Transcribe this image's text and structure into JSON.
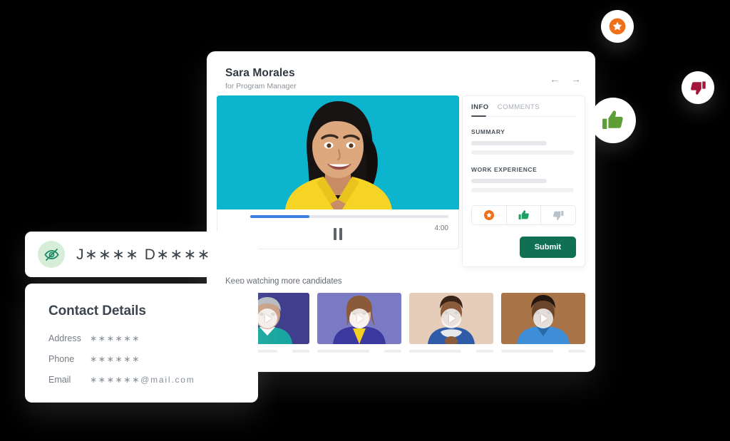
{
  "window": {
    "candidate_name": "Sara Morales",
    "candidate_role": "for Program Manager",
    "nav": {
      "prev": "←",
      "next": "→"
    }
  },
  "video": {
    "time_remaining": "4:00",
    "progress_percent": 30,
    "state": "playing",
    "background_color": "#0cb4ce",
    "progress_color": "#3b7fe0"
  },
  "panel": {
    "tabs": [
      {
        "label": "INFO",
        "active": true
      },
      {
        "label": "COMMENTS",
        "active": false
      }
    ],
    "sections": [
      {
        "title": "SUMMARY"
      },
      {
        "title": "WORK EXPERIENCE"
      }
    ],
    "reactions": [
      {
        "name": "star-badge-icon",
        "color": "#ef7018"
      },
      {
        "name": "thumbs-up-icon",
        "color": "#1f9d62"
      },
      {
        "name": "thumbs-down-icon",
        "color": "#b7c3cc"
      }
    ],
    "submit_label": "Submit",
    "submit_color": "#0f7054"
  },
  "keep_watching": {
    "heading": "Keep watching more candidates",
    "thumbnails": [
      {
        "name": "candidate-thumbnail-1",
        "bg": "#3f3f8e",
        "skin": "#c9a289",
        "shirt": "#1aa6a0",
        "hair": "#b9bcc2"
      },
      {
        "name": "candidate-thumbnail-2",
        "bg": "#7b7ac4",
        "skin": "#e0b79c",
        "shirt": "#3b38a0",
        "hair": "#8a5a3b"
      },
      {
        "name": "candidate-thumbnail-3",
        "bg": "#e6cdb9",
        "skin": "#8a5c3c",
        "shirt": "#2f5ba8",
        "hair": "#3a2418"
      },
      {
        "name": "candidate-thumbnail-4",
        "bg": "#a97448",
        "skin": "#6a4529",
        "shirt": "#3f8fd8",
        "hair": "#241610"
      }
    ]
  },
  "masked_card": {
    "icon": "eye-off-icon",
    "icon_color": "#1f8a6a",
    "icon_bg": "#d6eed8",
    "masked_name": "J∗∗∗∗ D∗∗∗∗"
  },
  "contact": {
    "title": "Contact Details",
    "rows": [
      {
        "label": "Address",
        "value": "∗∗∗∗∗∗",
        "suffix": ""
      },
      {
        "label": "Phone",
        "value": "∗∗∗∗∗∗",
        "suffix": ""
      },
      {
        "label": "Email",
        "value": "∗∗∗∗∗∗",
        "suffix": " @mail.com"
      }
    ]
  },
  "floating_badges": [
    {
      "name": "star-badge",
      "icon": "star-badge-icon",
      "color": "#ef7018"
    },
    {
      "name": "thumbs-down-badge",
      "icon": "thumbs-down-icon",
      "color": "#a31639"
    },
    {
      "name": "thumbs-up-badge",
      "icon": "thumbs-up-icon",
      "color": "#5f9d36"
    }
  ]
}
